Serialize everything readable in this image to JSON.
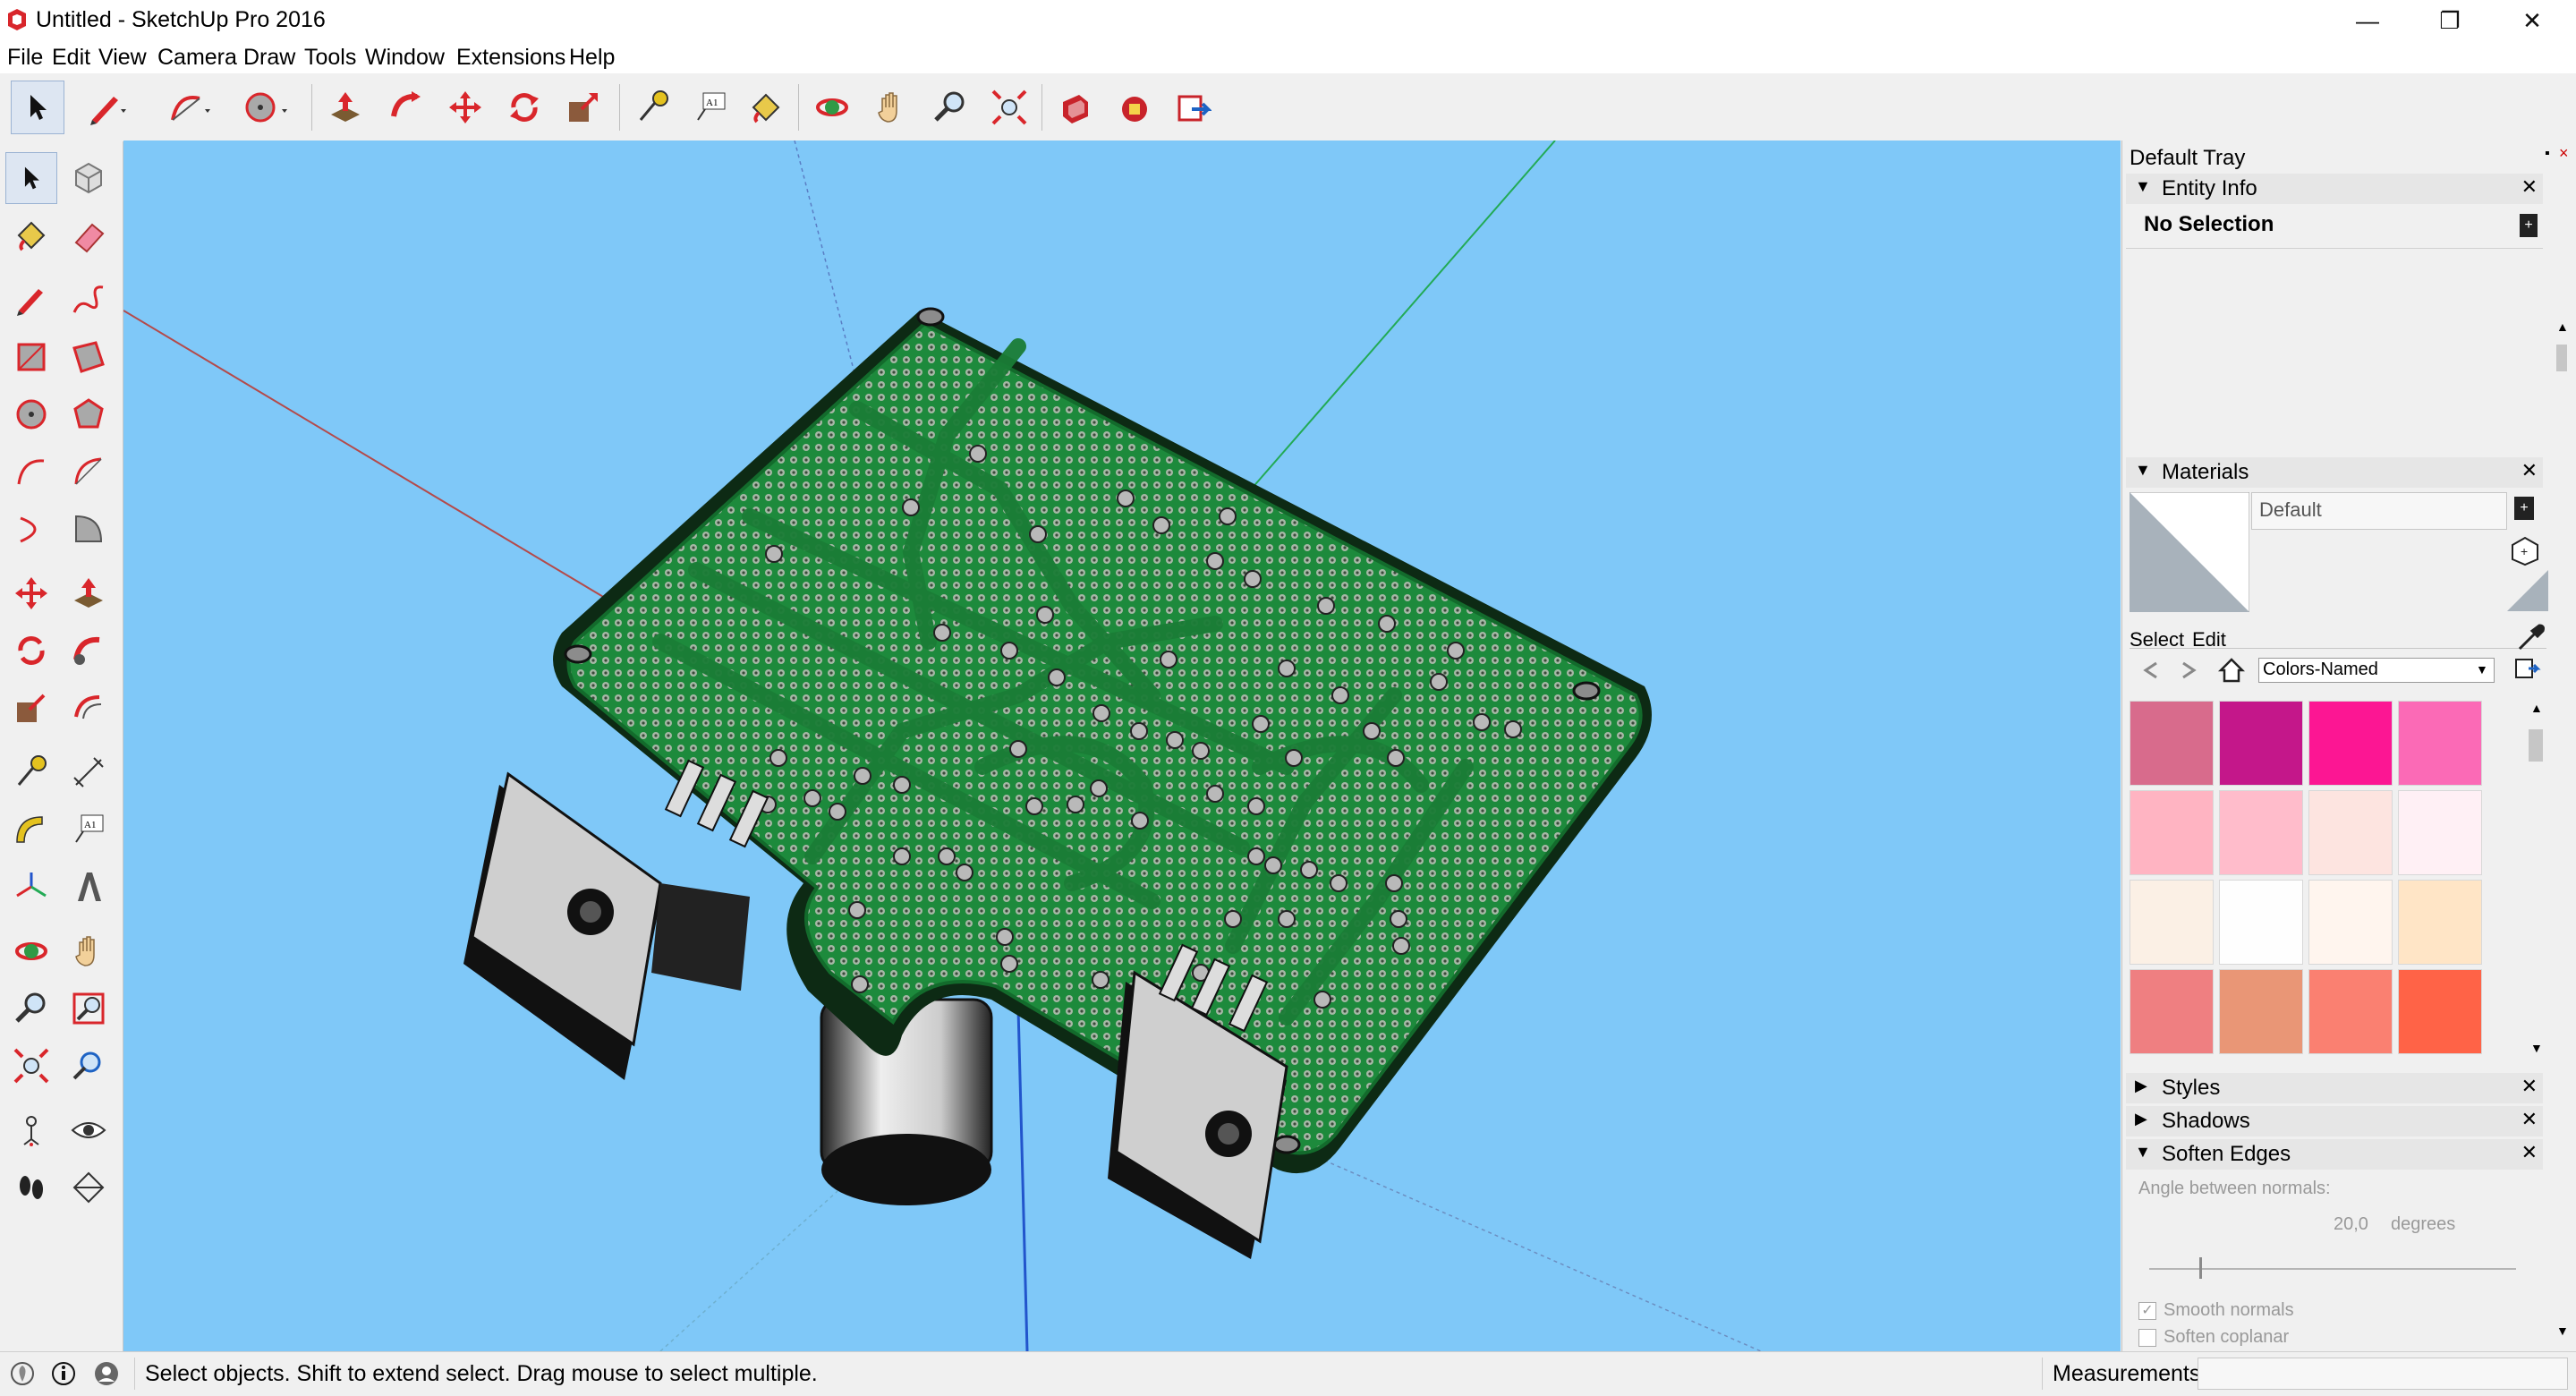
{
  "window": {
    "title": "Untitled - SketchUp Pro 2016",
    "controls": [
      "—",
      "❐",
      "✕"
    ]
  },
  "menu": [
    "File",
    "Edit",
    "View",
    "Camera",
    "Draw",
    "Tools",
    "Window",
    "Extensions",
    "Help"
  ],
  "toolbar": {
    "items": [
      "select-tool",
      "pencil-line-tool",
      "arc-tool",
      "circle-tool",
      "push-pull-tool",
      "follow-me-tool",
      "move-tool",
      "rotate-tool",
      "scale-tool",
      "tape-measure-tool",
      "text-tool",
      "paint-bucket-tool",
      "orbit-tool",
      "pan-tool",
      "zoom-tool",
      "zoom-extents-tool",
      "3d-warehouse",
      "extension-warehouse",
      "send-to-layout"
    ]
  },
  "left_palette": {
    "text_tool_glyph": "A1"
  },
  "tray": {
    "title": "Default Tray",
    "entity_info": {
      "label": "Entity Info",
      "selection": "No Selection"
    },
    "materials": {
      "label": "Materials",
      "name_value": "Default",
      "tab_select": "Select",
      "tab_edit": "Edit",
      "library": "Colors-Named",
      "swatches": [
        "#d86b8c",
        "#c4178a",
        "#fc1693",
        "#fb6ab6",
        "#ffb4c2",
        "#ffbccb",
        "#fde4e0",
        "#fff0f5",
        "#fbf0e5",
        "#fefefe",
        "#fff5ee",
        "#ffe5c6",
        "#ef7f81",
        "#e99676",
        "#fa8071",
        "#ff6347"
      ]
    },
    "styles": {
      "label": "Styles"
    },
    "shadows": {
      "label": "Shadows"
    },
    "soften_edges": {
      "label": "Soften Edges",
      "angle_label": "Angle between normals:",
      "angle_value": "20,0",
      "angle_unit": "degrees",
      "smooth_normals": "Smooth normals",
      "smooth_checked": true,
      "soften_coplanar": "Soften coplanar",
      "coplanar_checked": false
    }
  },
  "status": {
    "message": "Select objects. Shift to extend select. Drag mouse to select multiple.",
    "measurements_label": "Measurements",
    "measurements_value": ""
  },
  "colors": {
    "viewport_sky": "#7fc8f8",
    "pcb_green": "#1d8a3c",
    "pcb_dark": "#136b2c",
    "pcb_outline": "#0d2a14",
    "axis_red": "#b44a4a",
    "axis_green": "#22aa55",
    "axis_blue": "#2255cc"
  }
}
